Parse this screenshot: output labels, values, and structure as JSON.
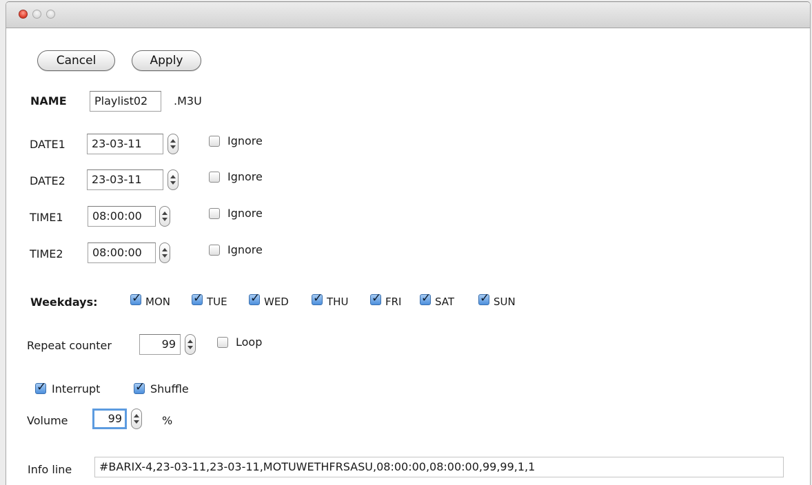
{
  "buttons": {
    "cancel": "Cancel",
    "apply": "Apply"
  },
  "name": {
    "label": "NAME",
    "value": "Playlist02",
    "ext": ".M3U"
  },
  "date1": {
    "label": "DATE1",
    "value": "23-03-11",
    "ignore_label": "Ignore",
    "ignore_checked": false
  },
  "date2": {
    "label": "DATE2",
    "value": "23-03-11",
    "ignore_label": "Ignore",
    "ignore_checked": false
  },
  "time1": {
    "label": "TIME1",
    "value": "08:00:00",
    "ignore_label": "Ignore",
    "ignore_checked": false
  },
  "time2": {
    "label": "TIME2",
    "value": "08:00:00",
    "ignore_label": "Ignore",
    "ignore_checked": false
  },
  "weekdays": {
    "label": "Weekdays:",
    "days": [
      {
        "label": "MON",
        "checked": true
      },
      {
        "label": "TUE",
        "checked": true
      },
      {
        "label": "WED",
        "checked": true
      },
      {
        "label": "THU",
        "checked": true
      },
      {
        "label": "FRI",
        "checked": true
      },
      {
        "label": "SAT",
        "checked": true
      },
      {
        "label": "SUN",
        "checked": true
      }
    ]
  },
  "repeat": {
    "label": "Repeat counter",
    "value": "99",
    "loop_label": "Loop",
    "loop_checked": false
  },
  "interrupt": {
    "label": "Interrupt",
    "checked": true
  },
  "shuffle": {
    "label": "Shuffle",
    "checked": true
  },
  "volume": {
    "label": "Volume",
    "value": "99",
    "unit": "%"
  },
  "info": {
    "label": "Info line",
    "value": "#BARIX-4,23-03-11,23-03-11,MOTUWETHFRSASU,08:00:00,08:00:00,99,99,1,1"
  },
  "colors": {
    "accent": "#4d90dd",
    "focus_ring": "#5c9be0",
    "close_button": "#e0422f"
  }
}
